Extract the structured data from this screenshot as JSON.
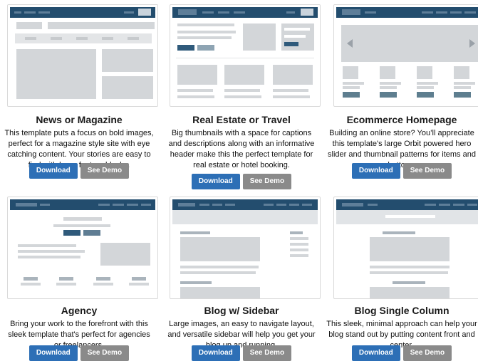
{
  "download_label": "Download",
  "demo_label": "See Demo",
  "templates": [
    {
      "title": "News or Magazine",
      "description": "This template puts a focus on bold images, perfect for a magazine style site with eye catching content. Your stories are easy to find with large feature blocks."
    },
    {
      "title": "Real Estate or Travel",
      "description": "Big thumbnails with a space for captions and descriptions along with an informative header make this the perfect template for real estate or hotel booking."
    },
    {
      "title": "Ecommerce Homepage",
      "description": "Building an online store? You’ll appreciate this template's large Orbit powered hero slider and thumbnail patterns for items and buttons."
    },
    {
      "title": "Agency",
      "description": "Bring your work to the forefront with this sleek template that's perfect for agencies or freelancers."
    },
    {
      "title": "Blog w/ Sidebar",
      "description": "Large images, an easy to navigate layout, and versatile sidebar will help you get your blog up and running."
    },
    {
      "title": "Blog Single Column",
      "description": "This sleek, minimal approach can help your blog stand out by putting content front and center."
    }
  ]
}
